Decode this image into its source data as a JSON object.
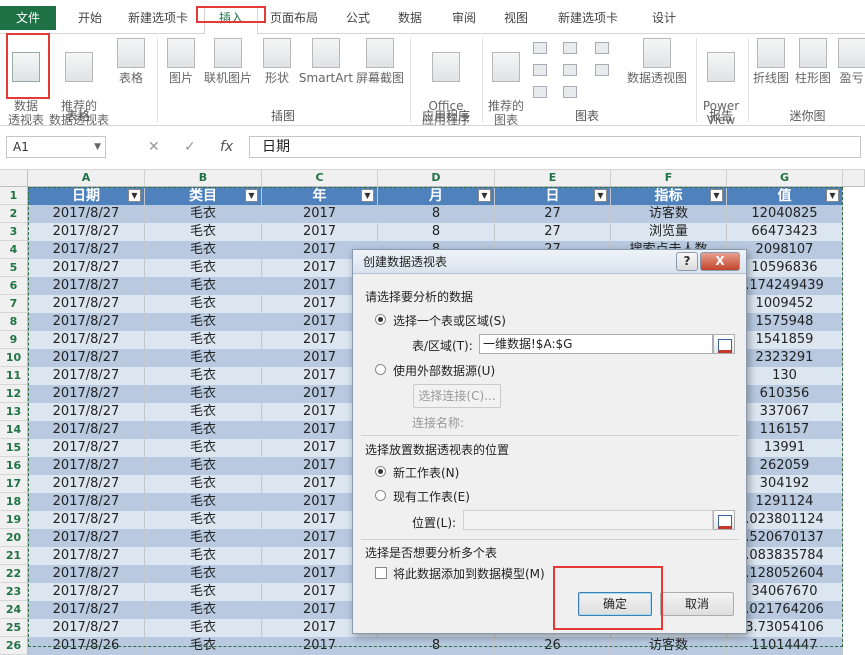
{
  "tabs": [
    "文件",
    "开始",
    "新建选项卡",
    "插入",
    "页面布局",
    "公式",
    "数据",
    "审阅",
    "视图",
    "新建选项卡",
    "设计"
  ],
  "ribbon": {
    "buttons": {
      "pivot": "数据\n透视表",
      "rec_pivot": "推荐的\n数据透视表",
      "table": "表格",
      "picture": "图片",
      "online_picture": "联机图片",
      "shapes": "形状",
      "smartart": "SmartArt",
      "screenshot": "屏幕截图",
      "office_apps": "Office\n应用程序",
      "rec_charts": "推荐的\n图表",
      "pivot_chart": "数据透视图",
      "power_view": "Power\nView",
      "line": "折线图",
      "column": "柱形图",
      "winloss": "盈亏"
    },
    "groups": [
      "表格",
      "插图",
      "应用程序",
      "图表",
      "报告",
      "迷你图"
    ]
  },
  "formula_bar": {
    "name_box": "A1",
    "fx": "fx",
    "content": "日期"
  },
  "sheet": {
    "columns": [
      "A",
      "B",
      "C",
      "D",
      "E",
      "F",
      "G"
    ],
    "headers": [
      "日期",
      "类目",
      "年",
      "月",
      "日",
      "指标",
      "值"
    ],
    "row_numbers": [
      "1",
      "2",
      "3",
      "4",
      "5",
      "6",
      "7",
      "8",
      "9",
      "10",
      "11",
      "12",
      "13",
      "14",
      "15",
      "16",
      "17",
      "18",
      "19",
      "20",
      "21",
      "22",
      "23",
      "24",
      "25",
      "26"
    ],
    "rows": [
      [
        "2017/8/27",
        "毛衣",
        "2017",
        "8",
        "27",
        "访客数",
        "12040825"
      ],
      [
        "2017/8/27",
        "毛衣",
        "2017",
        "8",
        "27",
        "浏览量",
        "66473423"
      ],
      [
        "2017/8/27",
        "毛衣",
        "2017",
        "8",
        "27",
        "搜索点击人数",
        "2098107"
      ],
      [
        "2017/8/27",
        "毛衣",
        "2017",
        "8",
        "27",
        "",
        "10596836"
      ],
      [
        "2017/8/27",
        "毛衣",
        "2017",
        "8",
        "27",
        "",
        ".174249439"
      ],
      [
        "2017/8/27",
        "毛衣",
        "2017",
        "8",
        "27",
        "",
        "1009452"
      ],
      [
        "2017/8/27",
        "毛衣",
        "2017",
        "8",
        "27",
        "",
        "1575948"
      ],
      [
        "2017/8/27",
        "毛衣",
        "2017",
        "8",
        "27",
        "",
        "1541859"
      ],
      [
        "2017/8/27",
        "毛衣",
        "2017",
        "8",
        "27",
        "",
        "2323291"
      ],
      [
        "2017/8/27",
        "毛衣",
        "2017",
        "8",
        "27",
        "",
        "130"
      ],
      [
        "2017/8/27",
        "毛衣",
        "2017",
        "8",
        "27",
        "",
        "610356"
      ],
      [
        "2017/8/27",
        "毛衣",
        "2017",
        "8",
        "27",
        "",
        "337067"
      ],
      [
        "2017/8/27",
        "毛衣",
        "2017",
        "8",
        "27",
        "",
        "116157"
      ],
      [
        "2017/8/27",
        "毛衣",
        "2017",
        "8",
        "27",
        "",
        "13991"
      ],
      [
        "2017/8/27",
        "毛衣",
        "2017",
        "8",
        "27",
        "",
        "262059"
      ],
      [
        "2017/8/27",
        "毛衣",
        "2017",
        "8",
        "27",
        "",
        "304192"
      ],
      [
        "2017/8/27",
        "毛衣",
        "2017",
        "8",
        "27",
        "",
        "1291124"
      ],
      [
        "2017/8/27",
        "毛衣",
        "2017",
        "8",
        "27",
        "",
        ".023801124"
      ],
      [
        "2017/8/27",
        "毛衣",
        "2017",
        "8",
        "27",
        "",
        ".520670137"
      ],
      [
        "2017/8/27",
        "毛衣",
        "2017",
        "8",
        "27",
        "",
        ".083835784"
      ],
      [
        "2017/8/27",
        "毛衣",
        "2017",
        "8",
        "27",
        "",
        ".128052604"
      ],
      [
        "2017/8/27",
        "毛衣",
        "2017",
        "8",
        "27",
        "",
        "34067670"
      ],
      [
        "2017/8/27",
        "毛衣",
        "2017",
        "8",
        "27",
        "",
        ".021764206"
      ],
      [
        "2017/8/27",
        "毛衣",
        "2017",
        "8",
        "27",
        "",
        "3.73054106"
      ],
      [
        "2017/8/26",
        "毛衣",
        "2017",
        "8",
        "26",
        "访客数",
        "11014447"
      ]
    ]
  },
  "dialog": {
    "title": "创建数据透视表",
    "help": "?",
    "close": "X",
    "section1": "请选择要分析的数据",
    "opt_range": "选择一个表或区域(S)",
    "range_label": "表/区域(T):",
    "range_value": "一维数据!$A:$G",
    "opt_external": "使用外部数据源(U)",
    "choose_conn": "选择连接(C)...",
    "conn_name": "连接名称:",
    "section2": "选择放置数据透视表的位置",
    "opt_new": "新工作表(N)",
    "opt_existing": "现有工作表(E)",
    "location_label": "位置(L):",
    "location_value": "",
    "section3": "选择是否想要分析多个表",
    "add_model": "将此数据添加到数据模型(M)",
    "ok": "确定",
    "cancel": "取消"
  }
}
